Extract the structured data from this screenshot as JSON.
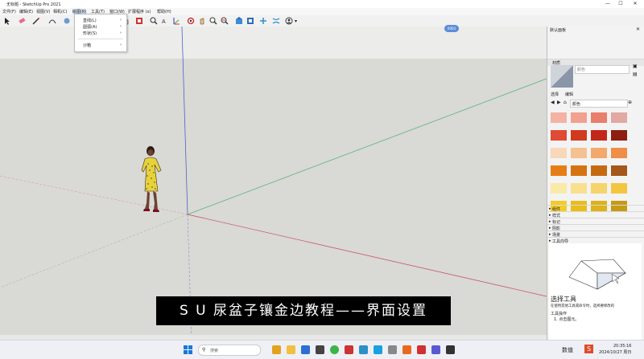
{
  "window": {
    "title": "无标题 - SketchUp Pro 2021",
    "controls": {
      "minimize": "—",
      "maximize": "☐",
      "close": "✕"
    }
  },
  "menubar": {
    "items": [
      "文件(F)",
      "编辑(E)",
      "视图(V)",
      "相机(C)",
      "绘图(R)",
      "工具(T)",
      "窗口(W)",
      "扩展程序 (x)",
      "帮助(H)"
    ]
  },
  "draw_menu": {
    "items": [
      {
        "label": "直线(L)",
        "arrow": "›"
      },
      {
        "label": "圆弧(A)",
        "arrow": "›"
      },
      {
        "label": "形状(S)",
        "arrow": "›"
      },
      {
        "label": "沙箱",
        "arrow": "›"
      }
    ]
  },
  "toolbar": {
    "icons": [
      "select-icon",
      "eraser-icon",
      "pencil-icon",
      "arc-icon",
      "paint-icon",
      "push-pull-icon",
      "move-icon",
      "rotate-icon",
      "scale-icon",
      "tape-icon",
      "text-icon",
      "axes-icon",
      "orbit-icon",
      "pan-icon",
      "zoom-icon",
      "zoom-extents-icon",
      "warehouse-icon",
      "extension-icon",
      "user-icon"
    ]
  },
  "viewport": {
    "badge": "0003",
    "colors": {
      "red_axis": "#c9455a",
      "green_axis": "#4caf70",
      "blue_axis": "#5060c8"
    }
  },
  "subtitle": {
    "text": "S U 尿盆子镶金边教程——界面设置"
  },
  "right_panel": {
    "title": "默认面板",
    "materials": {
      "header": "材质",
      "name_field": "颜色",
      "tabs": [
        "选择",
        "编辑"
      ],
      "dropdown": "颜色",
      "swatches": [
        "#f4b2a5",
        "#f2a090",
        "#e97e6b",
        "#e2a8a3",
        "#e04b33",
        "#d03a1f",
        "#c2281a",
        "#8d1f12",
        "#f8d8b8",
        "#f5c191",
        "#f3a96b",
        "#ee8e48",
        "#e57e17",
        "#d67311",
        "#c66a12",
        "#a5561a",
        "#faeaa8",
        "#f8e08e",
        "#f5d46b",
        "#f3c640",
        "#f3cc24",
        "#e9bd1c",
        "#ddb21a",
        "#c69a14"
      ]
    },
    "trays": [
      "组件",
      "样式",
      "标记",
      "阴影",
      "场景",
      "工具向导"
    ],
    "instructor": {
      "title": "选择工具",
      "line1": "在使用其他工具或命令时，选择要修改的",
      "section": "工具操作",
      "step": "1. 点击图元。"
    }
  },
  "taskbar": {
    "search_placeholder": "搜索",
    "app_name": "数值",
    "time": "20:35:16",
    "date": "2024/10/27 周日"
  }
}
